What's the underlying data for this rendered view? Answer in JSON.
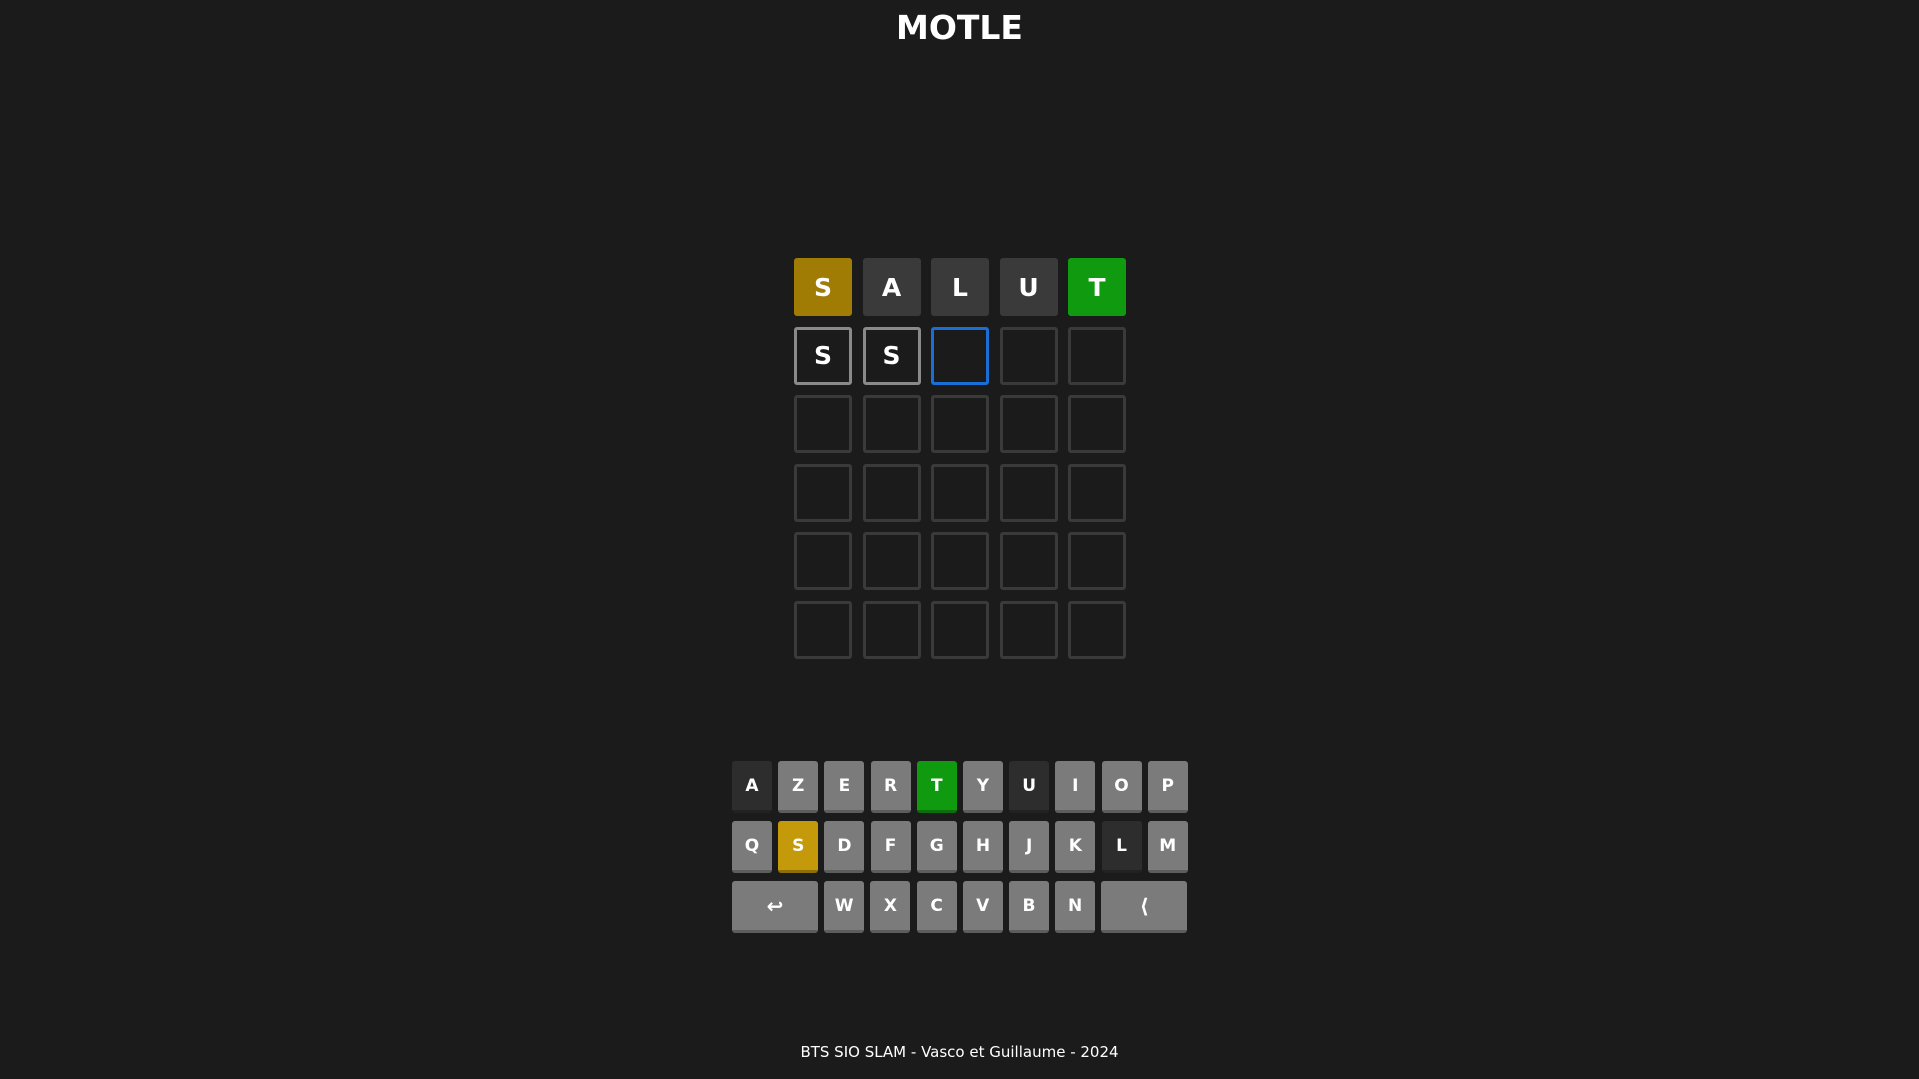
{
  "title": "MOTLE",
  "board": {
    "rows": [
      [
        {
          "letter": "S",
          "state": "present"
        },
        {
          "letter": "A",
          "state": "absent"
        },
        {
          "letter": "L",
          "state": "absent"
        },
        {
          "letter": "U",
          "state": "absent"
        },
        {
          "letter": "T",
          "state": "correct"
        }
      ],
      [
        {
          "letter": "S",
          "state": "filled"
        },
        {
          "letter": "S",
          "state": "filled"
        },
        {
          "letter": "",
          "state": "active"
        },
        {
          "letter": "",
          "state": "empty"
        },
        {
          "letter": "",
          "state": "empty"
        }
      ],
      [
        {
          "letter": "",
          "state": "empty"
        },
        {
          "letter": "",
          "state": "empty"
        },
        {
          "letter": "",
          "state": "empty"
        },
        {
          "letter": "",
          "state": "empty"
        },
        {
          "letter": "",
          "state": "empty"
        }
      ],
      [
        {
          "letter": "",
          "state": "empty"
        },
        {
          "letter": "",
          "state": "empty"
        },
        {
          "letter": "",
          "state": "empty"
        },
        {
          "letter": "",
          "state": "empty"
        },
        {
          "letter": "",
          "state": "empty"
        }
      ],
      [
        {
          "letter": "",
          "state": "empty"
        },
        {
          "letter": "",
          "state": "empty"
        },
        {
          "letter": "",
          "state": "empty"
        },
        {
          "letter": "",
          "state": "empty"
        },
        {
          "letter": "",
          "state": "empty"
        }
      ],
      [
        {
          "letter": "",
          "state": "empty"
        },
        {
          "letter": "",
          "state": "empty"
        },
        {
          "letter": "",
          "state": "empty"
        },
        {
          "letter": "",
          "state": "empty"
        },
        {
          "letter": "",
          "state": "empty"
        }
      ]
    ]
  },
  "keyboard": {
    "rows": [
      [
        {
          "label": "A",
          "state": "absent"
        },
        {
          "label": "Z",
          "state": "unused"
        },
        {
          "label": "E",
          "state": "unused"
        },
        {
          "label": "R",
          "state": "unused"
        },
        {
          "label": "T",
          "state": "correct"
        },
        {
          "label": "Y",
          "state": "unused"
        },
        {
          "label": "U",
          "state": "absent"
        },
        {
          "label": "I",
          "state": "unused"
        },
        {
          "label": "O",
          "state": "unused"
        },
        {
          "label": "P",
          "state": "unused"
        }
      ],
      [
        {
          "label": "Q",
          "state": "unused"
        },
        {
          "label": "S",
          "state": "present"
        },
        {
          "label": "D",
          "state": "unused"
        },
        {
          "label": "F",
          "state": "unused"
        },
        {
          "label": "G",
          "state": "unused"
        },
        {
          "label": "H",
          "state": "unused"
        },
        {
          "label": "J",
          "state": "unused"
        },
        {
          "label": "K",
          "state": "unused"
        },
        {
          "label": "L",
          "state": "absent"
        },
        {
          "label": "M",
          "state": "unused"
        }
      ],
      [
        {
          "label": "↩",
          "state": "unused",
          "wide": true,
          "icon": "enter-icon"
        },
        {
          "label": "W",
          "state": "unused"
        },
        {
          "label": "X",
          "state": "unused"
        },
        {
          "label": "C",
          "state": "unused"
        },
        {
          "label": "V",
          "state": "unused"
        },
        {
          "label": "B",
          "state": "unused"
        },
        {
          "label": "N",
          "state": "unused"
        },
        {
          "label": "⟨",
          "state": "unused",
          "wide": true,
          "icon": "backspace-icon"
        }
      ]
    ]
  },
  "colors": {
    "background": "#1b1b1b",
    "correct": "#0f9a0f",
    "present": "#a07c05",
    "absent": "#3a3a3a",
    "active_border": "#1a6fd6"
  },
  "footer": "BTS SIO SLAM - Vasco et Guillaume - 2024"
}
